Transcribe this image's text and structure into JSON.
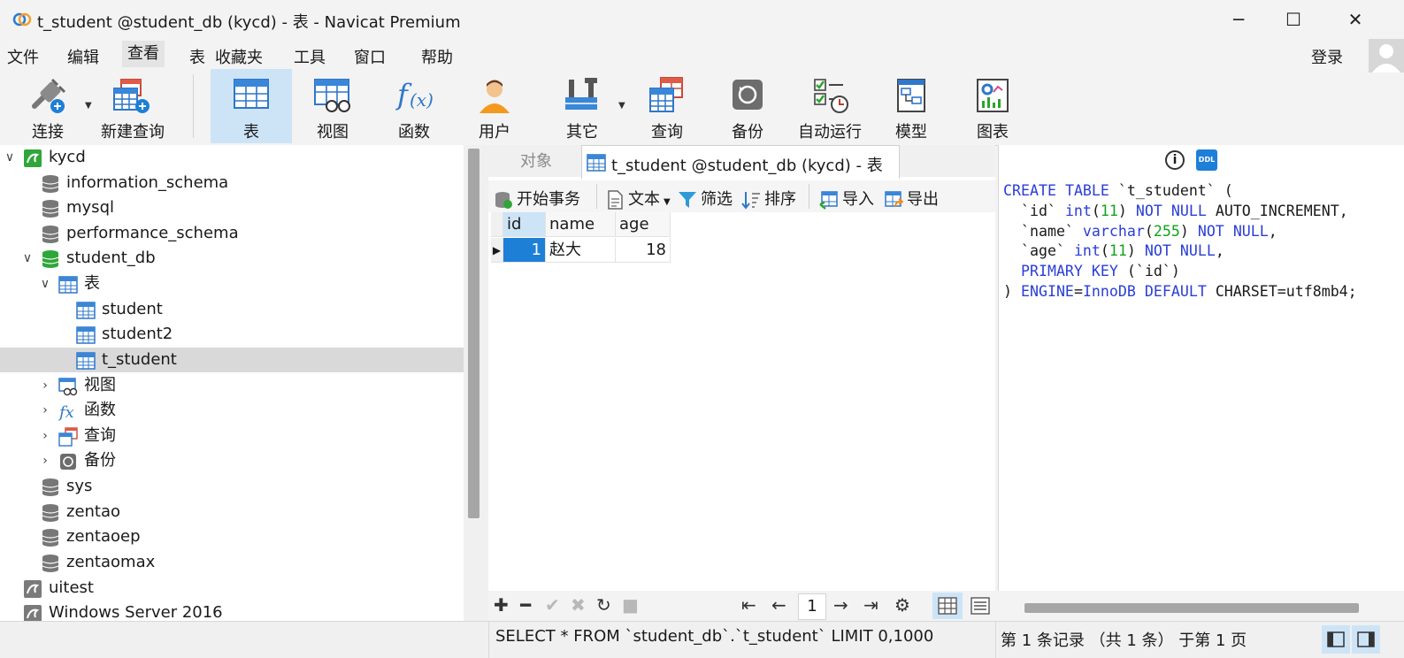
{
  "window": {
    "title": "t_student @student_db (kycd) - 表 - Navicat Premium",
    "controls": {
      "minimize": "─",
      "maximize": "☐",
      "close": "✕"
    }
  },
  "menu": {
    "items": [
      "文件",
      "编辑",
      "查看",
      "表",
      "收藏夹",
      "工具",
      "窗口",
      "帮助"
    ],
    "login": "登录"
  },
  "toolbar": {
    "items": [
      "连接",
      "新建查询",
      "表",
      "视图",
      "函数",
      "用户",
      "其它",
      "查询",
      "备份",
      "自动运行",
      "模型",
      "图表"
    ],
    "active": "表"
  },
  "tree": {
    "connection": "kycd",
    "databases": [
      "information_schema",
      "mysql",
      "performance_schema",
      "student_db"
    ],
    "student_db_children": {
      "tables_label": "表",
      "tables": [
        "student",
        "student2",
        "t_student"
      ],
      "views": "视图",
      "functions": "函数",
      "queries": "查询",
      "backups": "备份"
    },
    "more_databases": [
      "sys",
      "zentao",
      "zentaoep",
      "zentaomax"
    ],
    "connections": [
      "uitest",
      "Windows Server 2016"
    ],
    "selected": "t_student"
  },
  "tabs": {
    "objects": "对象",
    "active": "t_student @student_db (kycd) - 表"
  },
  "subtoolbar": {
    "begin_transaction": "开始事务",
    "text": "文本",
    "filter": "筛选",
    "sort": "排序",
    "import": "导入",
    "export": "导出"
  },
  "grid": {
    "columns": [
      "id",
      "name",
      "age"
    ],
    "rows": [
      {
        "id": "1",
        "name": "赵大",
        "age": "18"
      }
    ]
  },
  "pager": {
    "page": "1"
  },
  "ddl": {
    "lines": [
      "CREATE TABLE `t_student` (",
      "  `id` int(11) NOT NULL AUTO_INCREMENT,",
      "  `name` varchar(255) NOT NULL,",
      "  `age` int(11) NOT NULL,",
      "  PRIMARY KEY (`id`)",
      ") ENGINE=InnoDB DEFAULT CHARSET=utf8mb4;"
    ]
  },
  "status": {
    "sql": "SELECT * FROM `student_db`.`t_student` LIMIT 0,1000",
    "records": "第 1 条记录 （共 1 条） 于第 1 页"
  },
  "colors": {
    "accent": "#1e7fd6",
    "active_tab_bg": "#cde4f7",
    "keyword": "#2a3ed6",
    "number": "#11a31a"
  }
}
